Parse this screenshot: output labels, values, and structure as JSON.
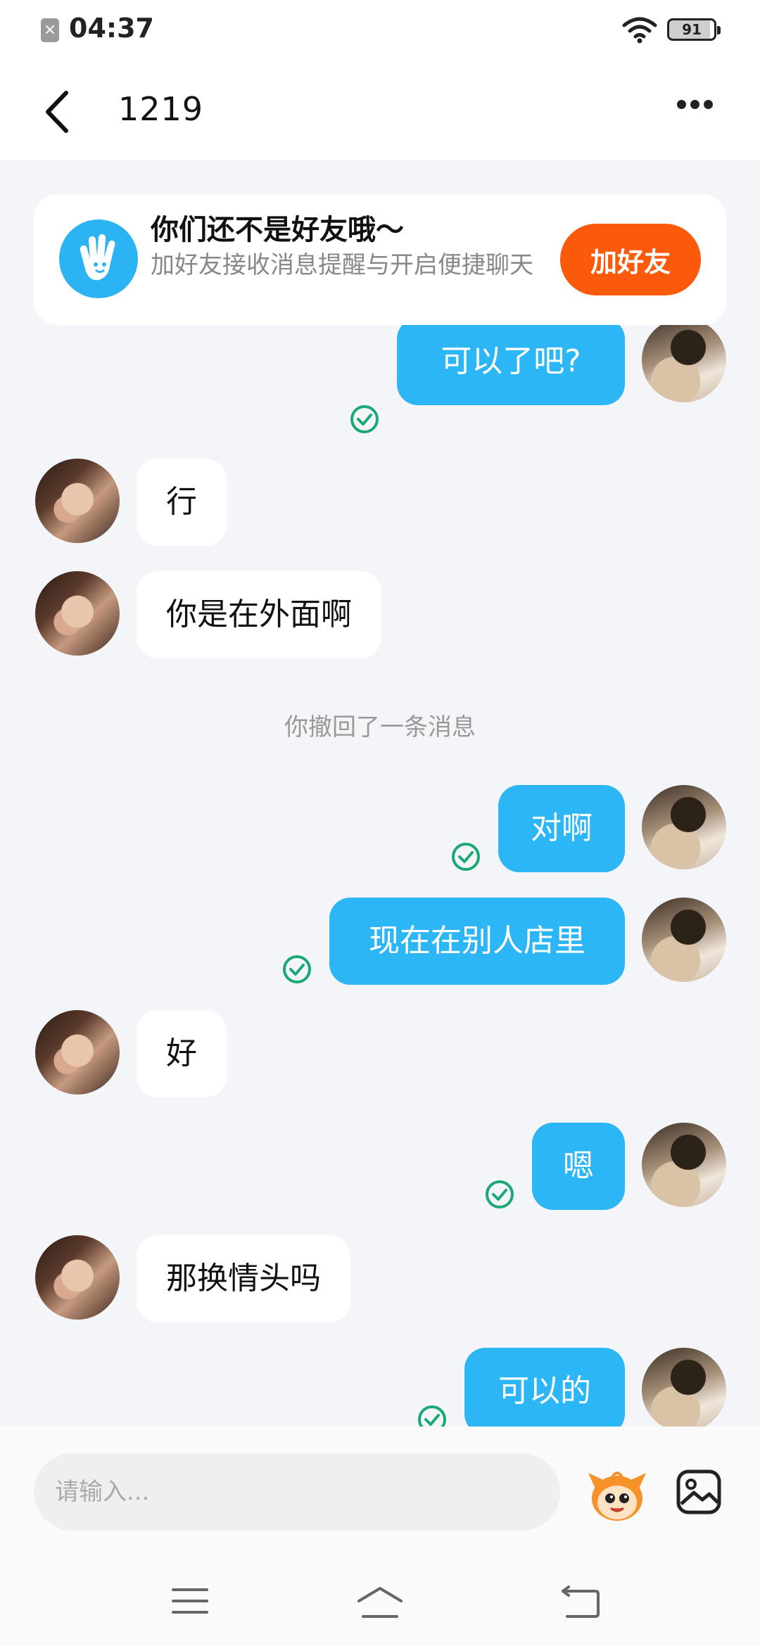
{
  "status_bar": {
    "time": "04:37",
    "battery": "91",
    "icons": [
      "sim-off-icon",
      "wifi-icon",
      "battery-icon"
    ]
  },
  "header": {
    "title": "1219",
    "icons": [
      "back-icon",
      "more-icon"
    ]
  },
  "friend_banner": {
    "title": "你们还不是好友哦～",
    "subtitle": "加好友接收消息提醒与开启便捷聊天",
    "button_label": "加好友",
    "icon": "wave-hand-icon"
  },
  "messages": [
    {
      "sender": "me",
      "text": "可以了吧?",
      "delivered": true
    },
    {
      "sender": "them",
      "text": "行"
    },
    {
      "sender": "them",
      "text": "你是在外面啊"
    },
    {
      "sender": "system",
      "text": "你撤回了一条消息"
    },
    {
      "sender": "me",
      "text": "对啊",
      "delivered": true
    },
    {
      "sender": "me",
      "text": "现在在别人店里",
      "delivered": true
    },
    {
      "sender": "them",
      "text": "好"
    },
    {
      "sender": "me",
      "text": "嗯",
      "delivered": true
    },
    {
      "sender": "them",
      "text": "那换情头吗"
    },
    {
      "sender": "me",
      "text": "可以的",
      "delivered": true
    }
  ],
  "input_bar": {
    "placeholder": "请输入...",
    "icons": [
      "sticker-icon",
      "image-icon"
    ]
  },
  "nav_bar": {
    "icons": [
      "menu-icon",
      "home-icon",
      "back-nav-icon"
    ]
  },
  "colors": {
    "my_bubble": "#2cb6f6",
    "their_bubble": "#ffffff",
    "add_friend_button": "#fb5a0d",
    "check_icon": "#1aa876",
    "background": "#f3f5f8"
  }
}
